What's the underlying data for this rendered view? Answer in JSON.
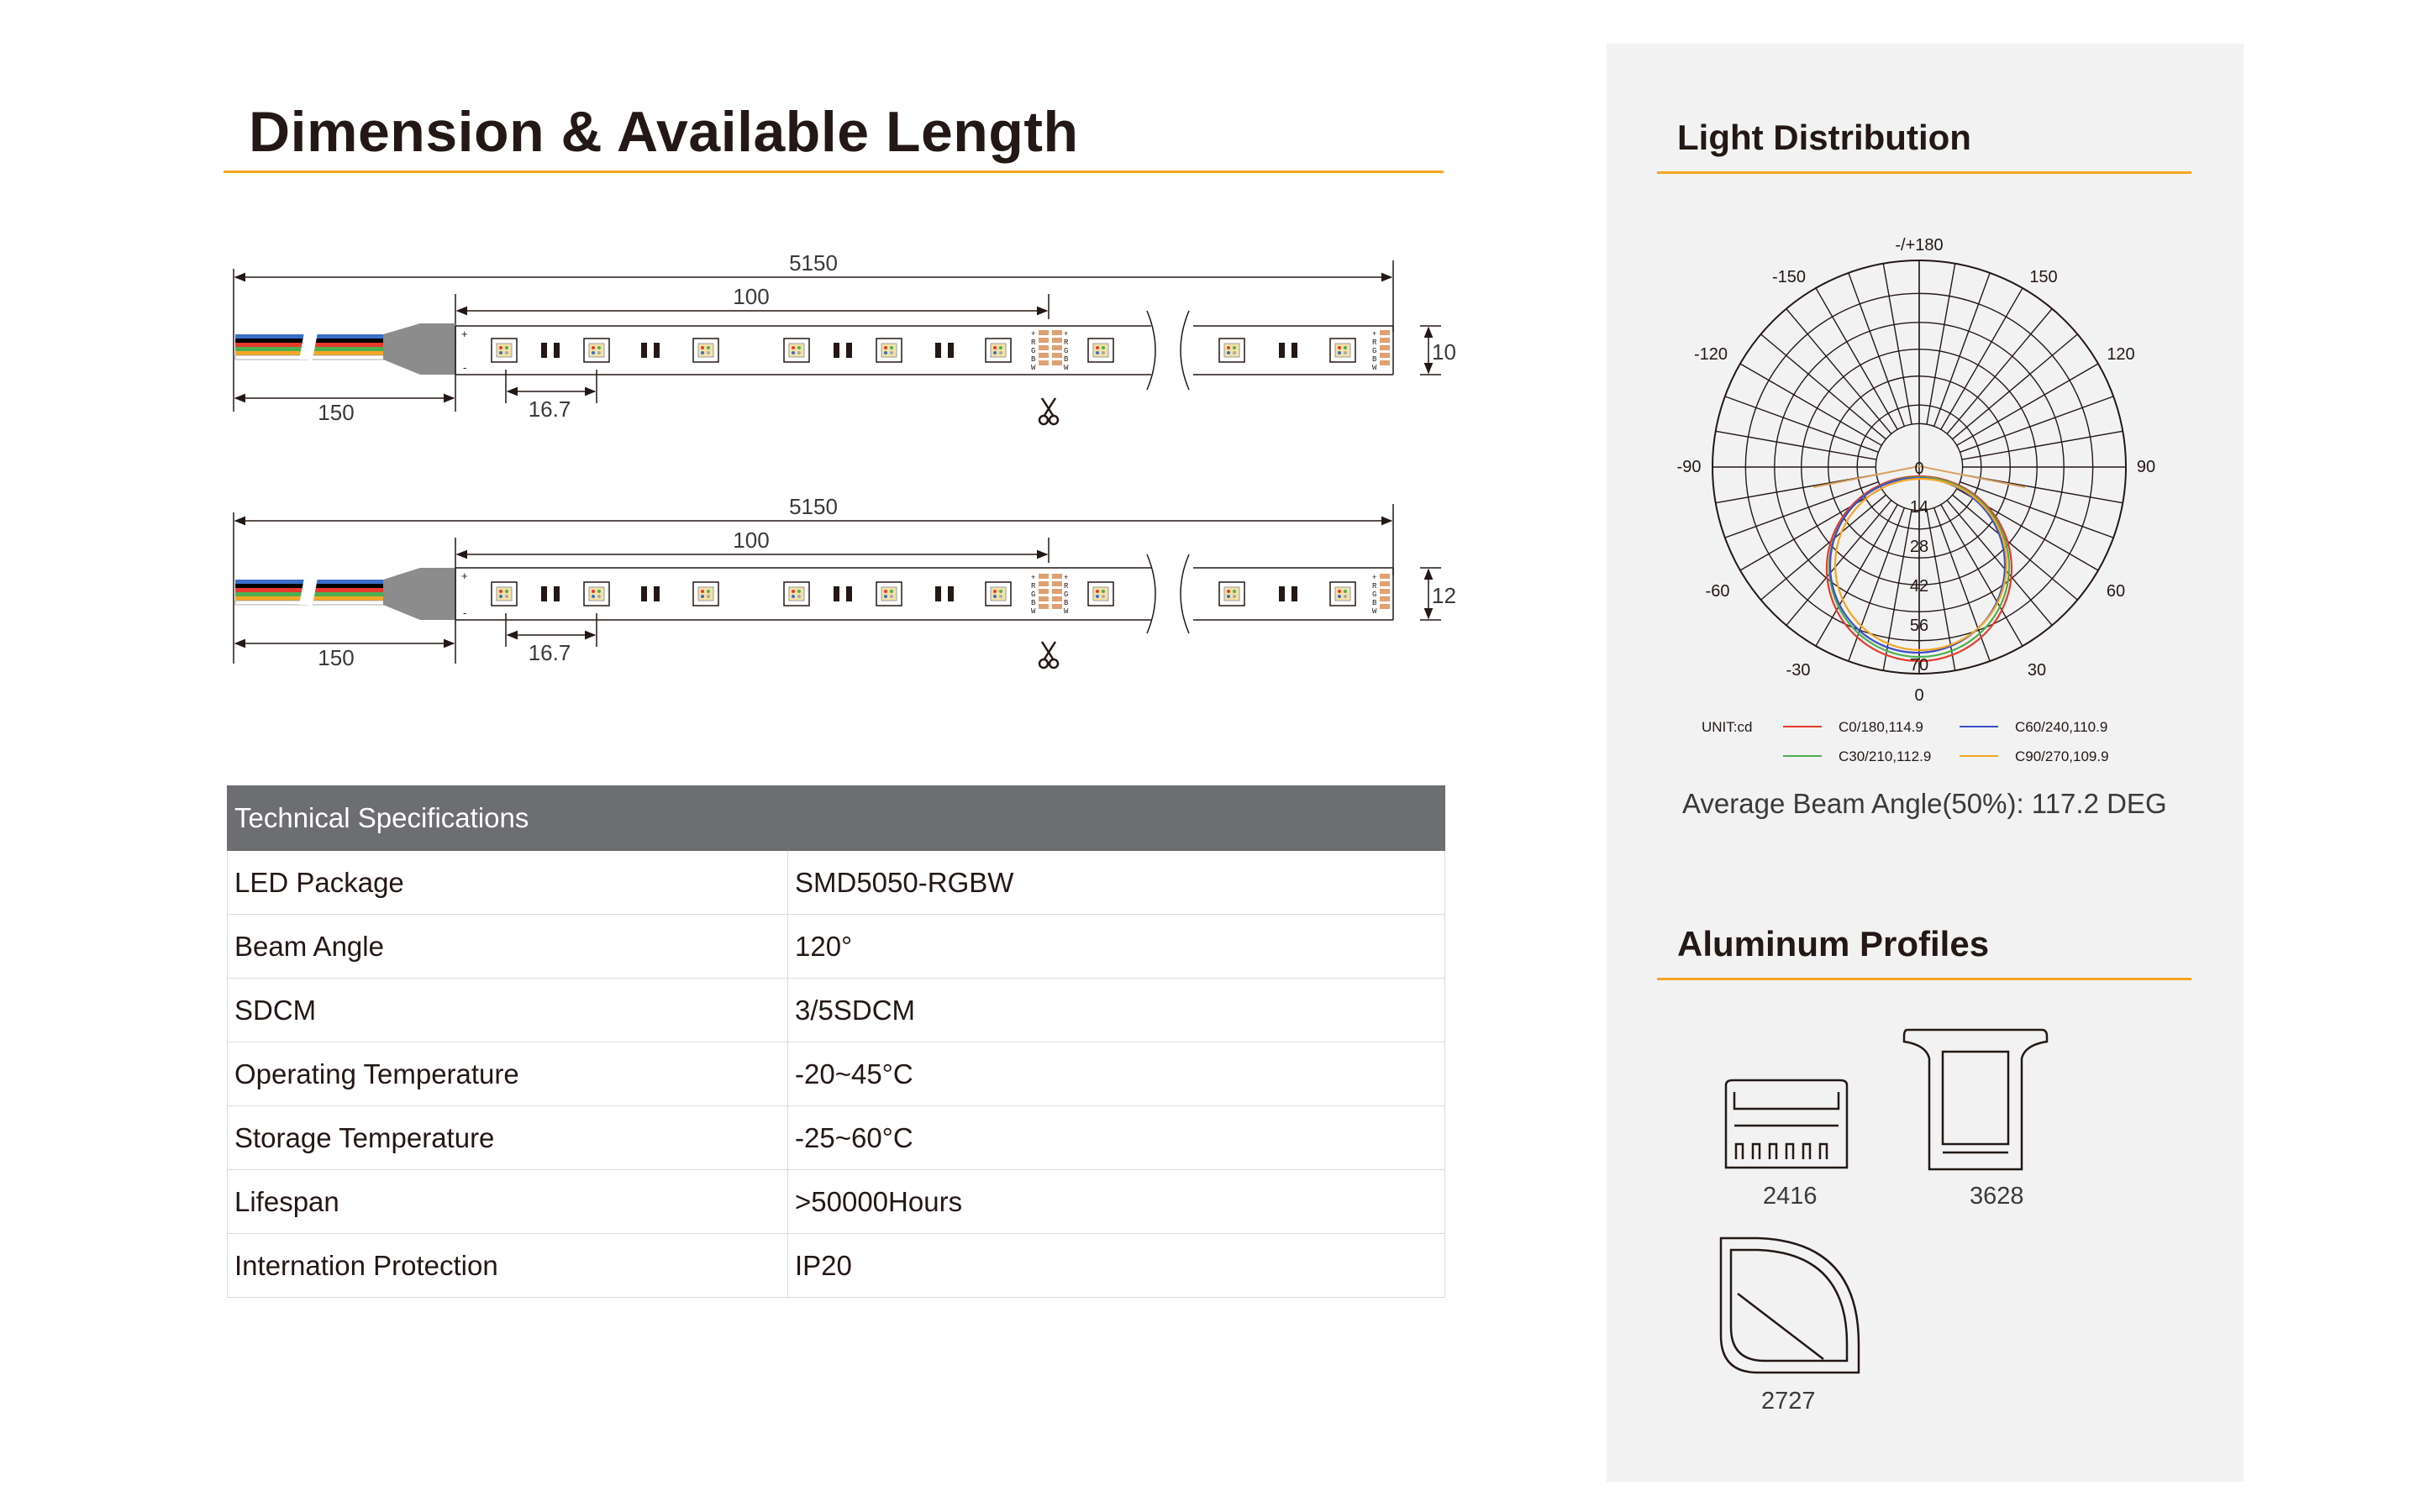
{
  "dimension": {
    "title": "Dimension & Available Length",
    "strips": [
      {
        "total": "5150",
        "segment": "100",
        "lead": "150",
        "pitch": "16.7",
        "width": "10"
      },
      {
        "total": "5150",
        "segment": "100",
        "lead": "150",
        "pitch": "16.7",
        "width": "12"
      }
    ],
    "pad_letters": [
      "+",
      "R",
      "G",
      "B",
      "W"
    ],
    "scissors_icon": "scissors-icon",
    "wire_colors": [
      "#3a6fc9",
      "#000000",
      "#e8392b",
      "#4caf50",
      "#f5a623",
      "#ffffff"
    ]
  },
  "specs": {
    "header": "Technical Specifications",
    "rows": [
      {
        "label": "LED Package",
        "value": "SMD5050-RGBW"
      },
      {
        "label": "Beam Angle",
        "value": "120°"
      },
      {
        "label": "SDCM",
        "value": "3/5SDCM"
      },
      {
        "label": "Operating Temperature",
        "value": "-20~45°C"
      },
      {
        "label": "Storage Temperature",
        "value": "-25~60°C"
      },
      {
        "label": "Lifespan",
        "value": ">50000Hours"
      },
      {
        "label": "Internation Protection",
        "value": "IP20"
      }
    ]
  },
  "light": {
    "title": "Light Distribution",
    "angle_labels": {
      "top": "-/+180",
      "tl150": "-150",
      "tr150": "150",
      "l120": "-120",
      "r120": "120",
      "l90": "-90",
      "r90": "90",
      "l60": "-60",
      "r60": "60",
      "l30": "-30",
      "r30": "30",
      "bottom": "0"
    },
    "radial_labels": [
      "0",
      "14",
      "28",
      "42",
      "56",
      "70"
    ],
    "unit": "UNIT:cd",
    "legend": [
      {
        "label": "C0/180,114.9",
        "color": "#e8392b"
      },
      {
        "label": "C60/240,110.9",
        "color": "#3a4fc9"
      },
      {
        "label": "C30/210,112.9",
        "color": "#4caf50"
      },
      {
        "label": "C90/270,109.9",
        "color": "#f5a623"
      }
    ],
    "beam_text": "Average Beam Angle(50%): 117.2 DEG"
  },
  "profiles": {
    "title": "Aluminum Profiles",
    "items": [
      "2416",
      "3628",
      "2727"
    ]
  },
  "colors": {
    "accent": "#f5a623",
    "table_header": "#6d6e71",
    "panel": "#f2f2f2"
  }
}
